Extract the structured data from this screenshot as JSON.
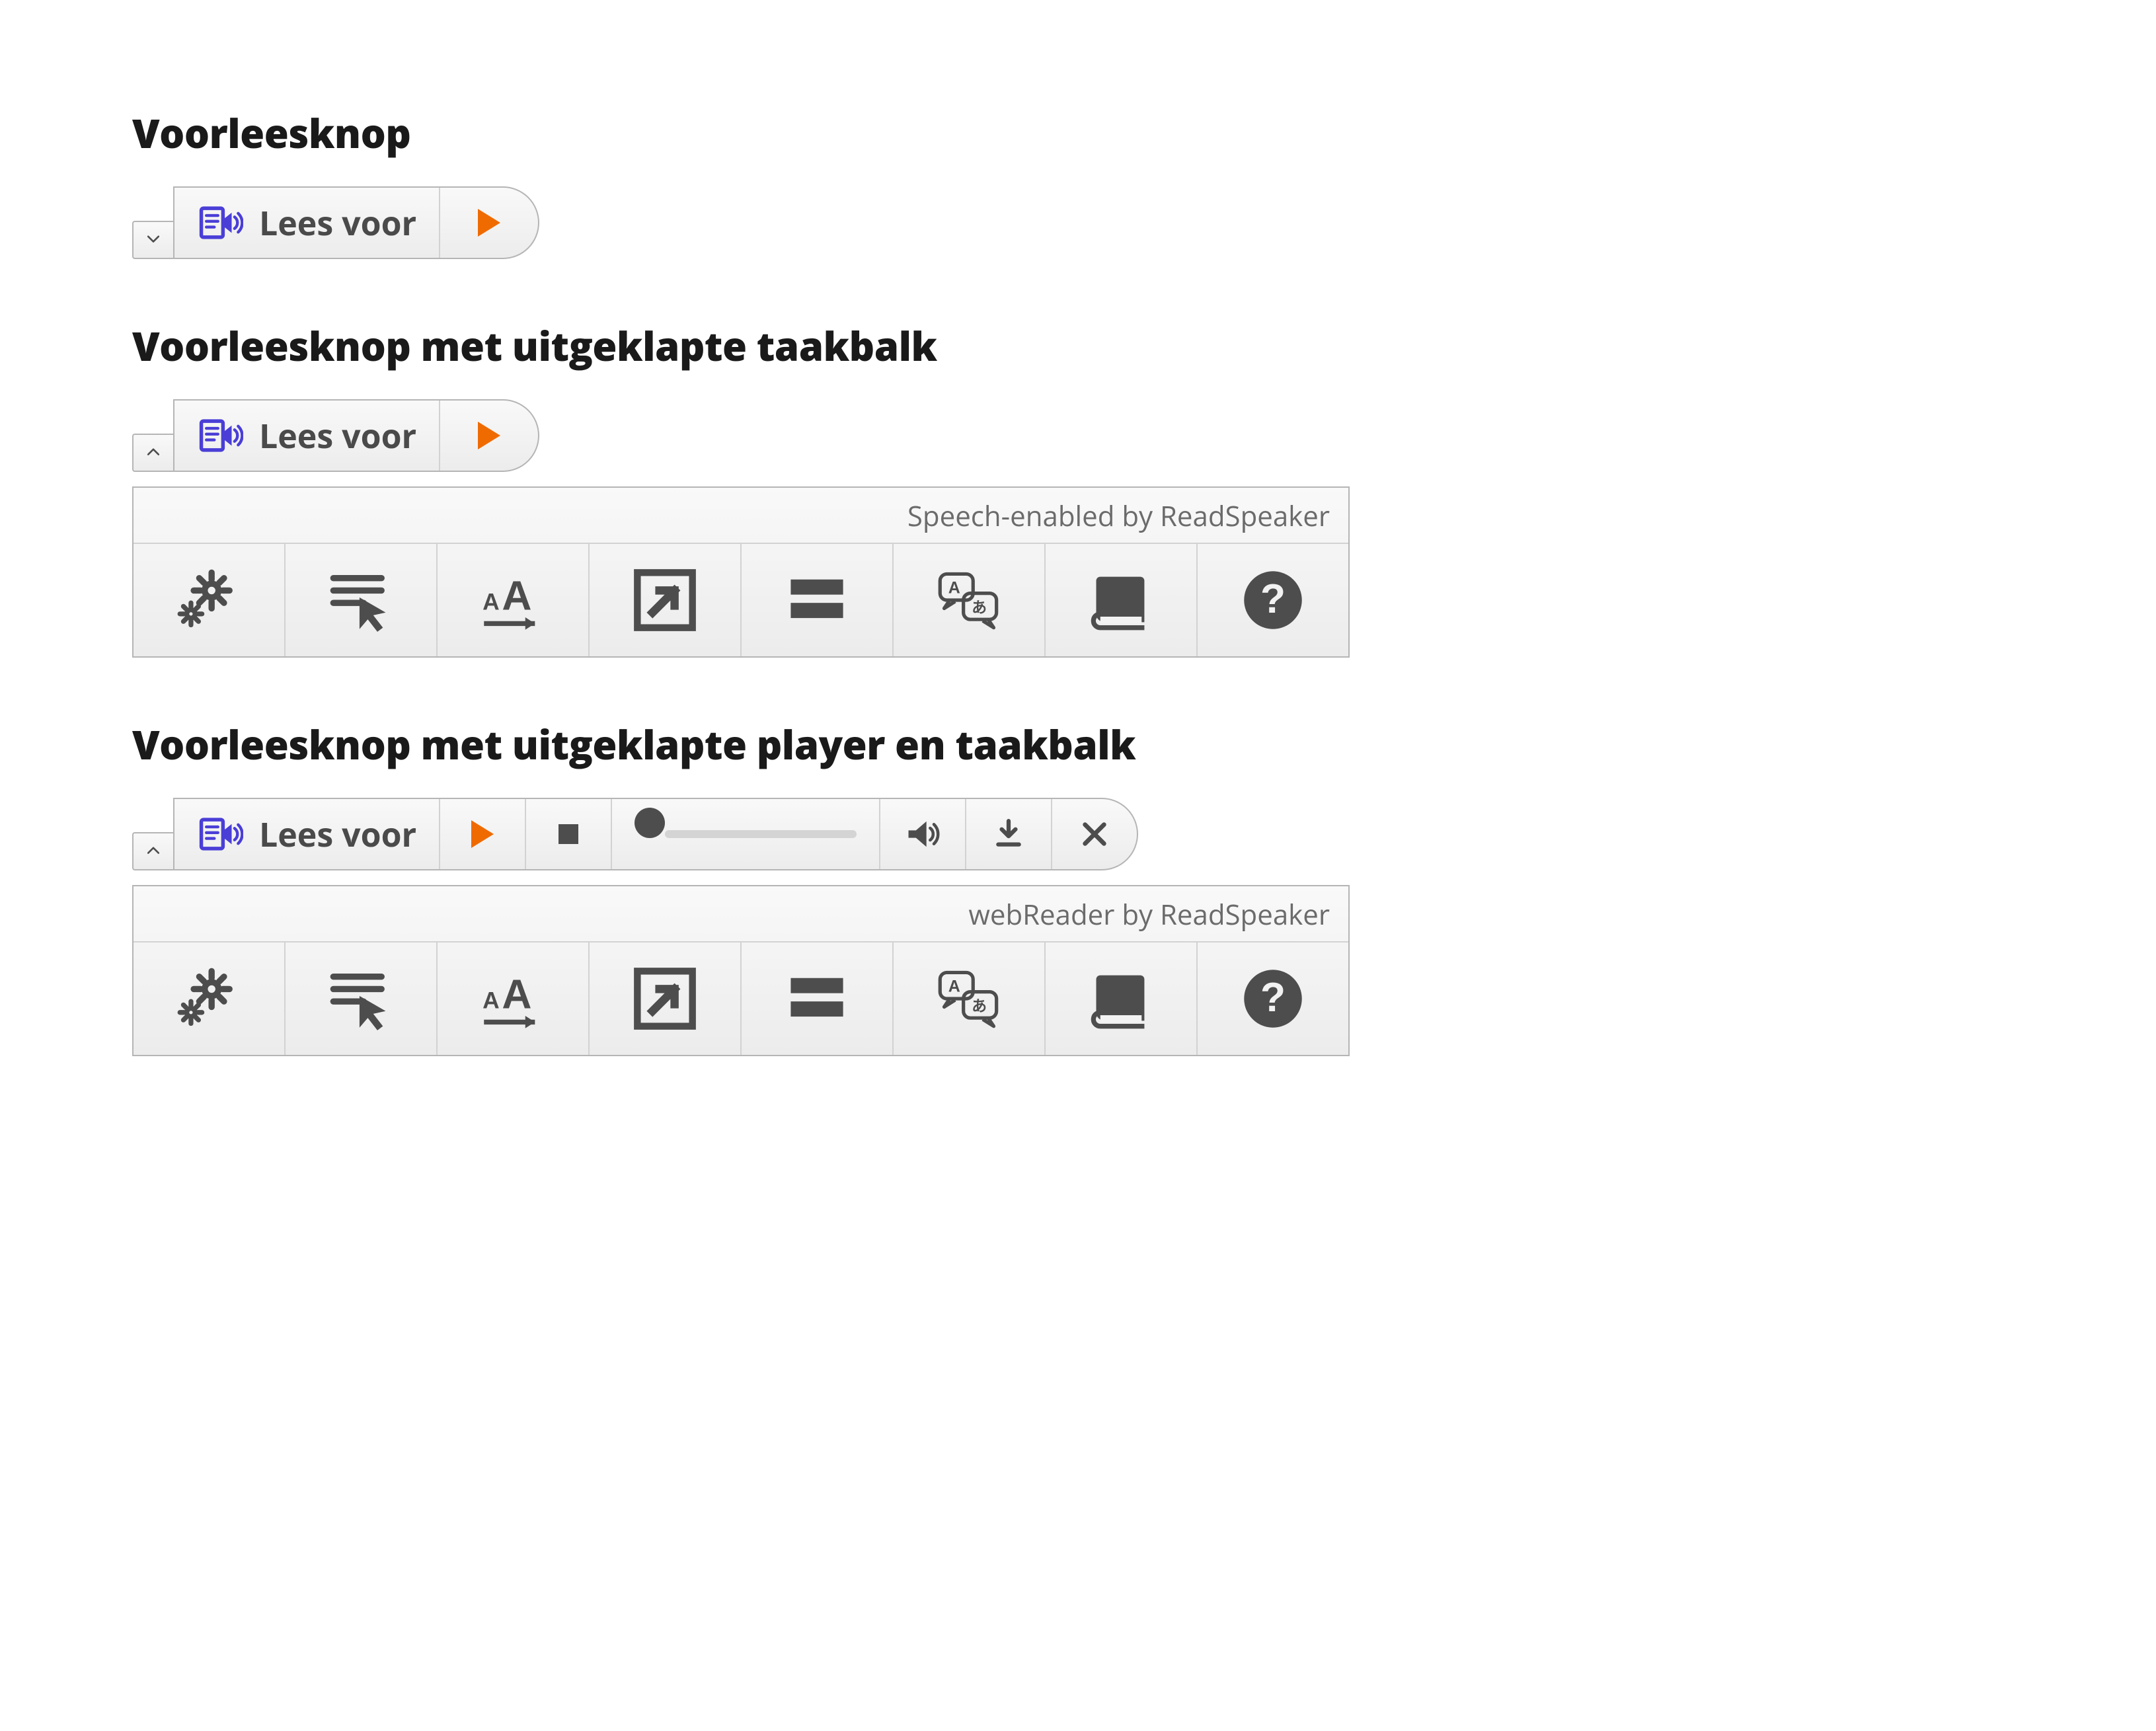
{
  "colors": {
    "accent_orange": "#ef6b00",
    "accent_purple": "#4a3ed7",
    "icon_grey": "#4d4d4d"
  },
  "sections": {
    "s1": {
      "title": "Voorleesknop"
    },
    "s2": {
      "title": "Voorleesknop met uitgeklapte taakbalk"
    },
    "s3": {
      "title": "Voorleesknop met uitgeklapte player en taakbalk"
    }
  },
  "listen": {
    "label": "Lees voor",
    "icon": "readspeaker-icon",
    "play_icon": "play-icon"
  },
  "expander": {
    "collapsed_icon": "chevron-down-icon",
    "expanded_icon": "chevron-up-icon"
  },
  "player": {
    "play_icon": "play-icon",
    "stop_icon": "stop-icon",
    "progress_value": 0,
    "volume_icon": "volume-icon",
    "download_icon": "download-icon",
    "close_icon": "close-icon"
  },
  "toolbar": {
    "credit_short": "Speech-enabled by ReadSpeaker",
    "credit_long": "webReader by ReadSpeaker",
    "items": [
      {
        "id": "settings",
        "icon": "gears-icon"
      },
      {
        "id": "click-to-listen",
        "icon": "text-cursor-icon"
      },
      {
        "id": "enlarge-text",
        "icon": "enlarge-text-icon"
      },
      {
        "id": "text-mode",
        "icon": "popup-arrow-icon"
      },
      {
        "id": "page-mask",
        "icon": "page-mask-icon"
      },
      {
        "id": "translate",
        "icon": "translate-icon"
      },
      {
        "id": "dictionary",
        "icon": "book-icon"
      },
      {
        "id": "help",
        "icon": "help-icon"
      }
    ]
  }
}
